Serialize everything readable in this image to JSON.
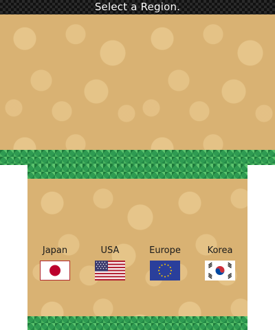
{
  "header": {
    "title": "Select a Region."
  },
  "regions": [
    {
      "id": "japan",
      "label": "Japan",
      "flag_icon": "japan-flag-icon"
    },
    {
      "id": "usa",
      "label": "USA",
      "flag_icon": "usa-flag-icon"
    },
    {
      "id": "europe",
      "label": "Europe",
      "flag_icon": "eu-flag-icon"
    },
    {
      "id": "korea",
      "label": "Korea",
      "flag_icon": "korea-flag-icon"
    }
  ],
  "colors": {
    "sand": "#d9b273",
    "grass": "#2f9b52",
    "title_bar": "#2a2a2a",
    "japan_red": "#bc002d",
    "usa_red": "#b22234",
    "usa_blue": "#3c3b6e",
    "eu_blue": "#2a3f9b",
    "eu_gold": "#ffcc00"
  }
}
